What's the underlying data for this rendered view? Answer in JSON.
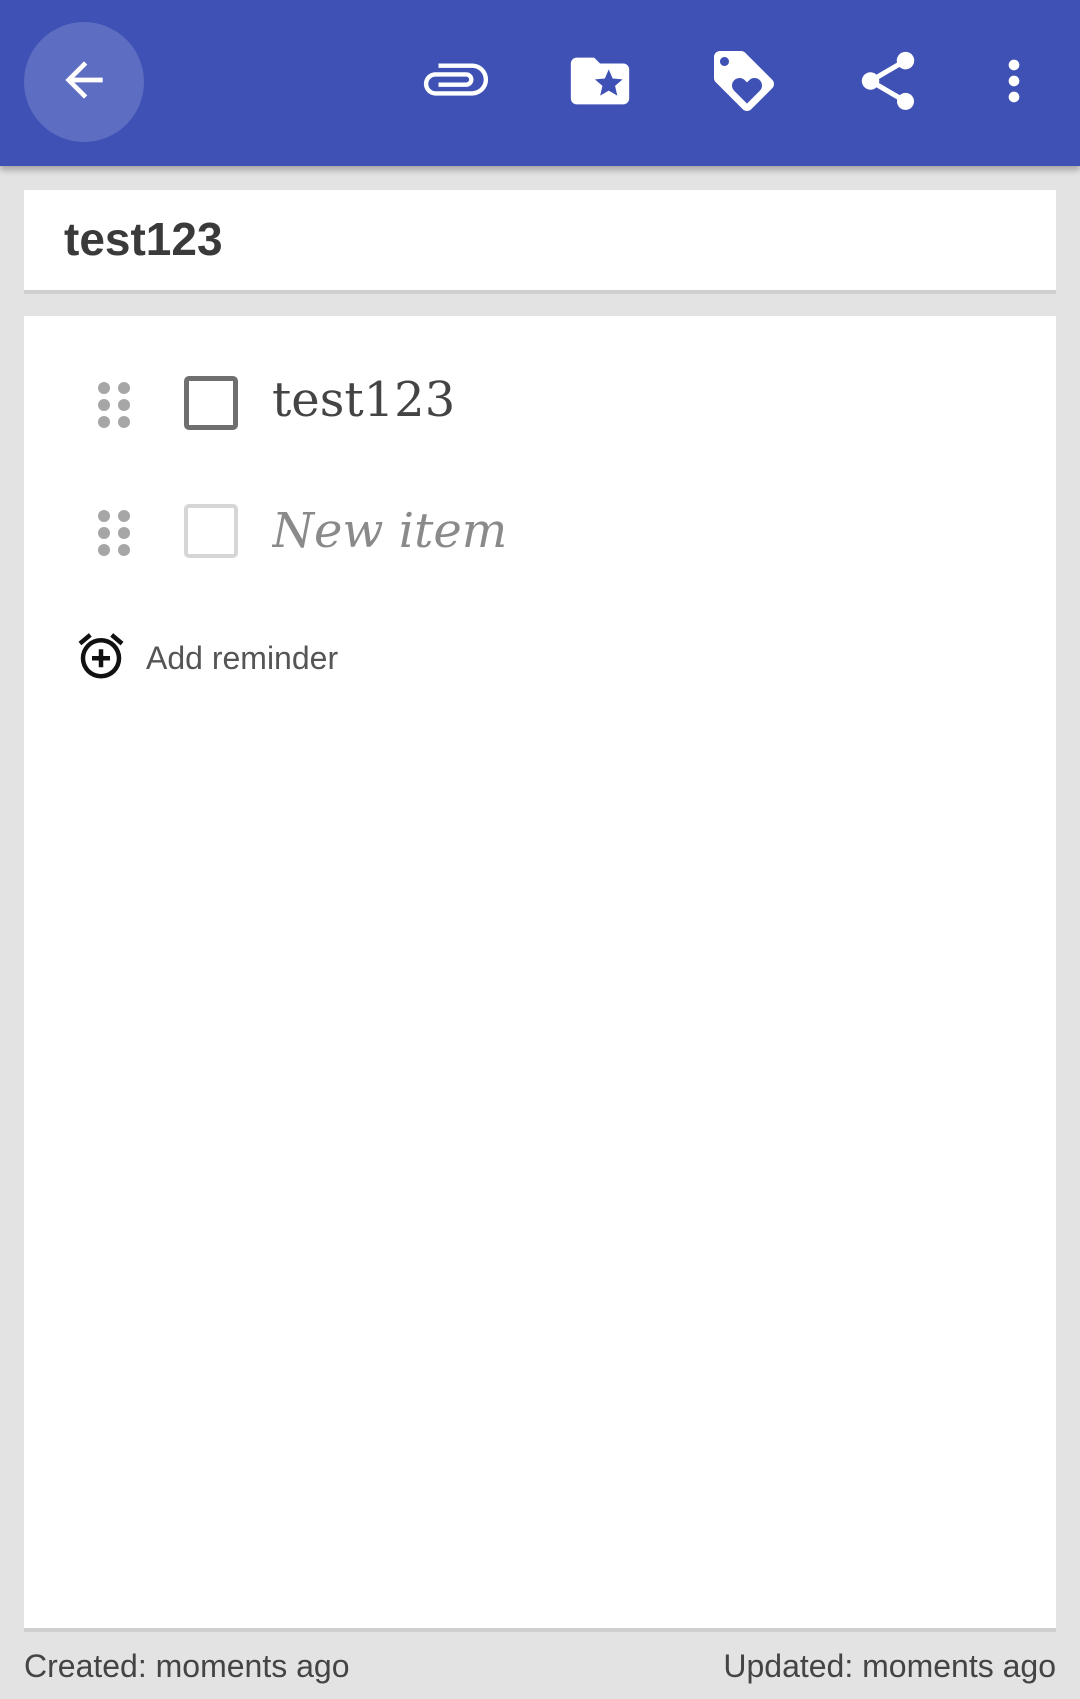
{
  "toolbar": {
    "background": "#3f51b5",
    "icons": [
      "back-arrow-icon",
      "paperclip-icon",
      "folder-star-icon",
      "tag-heart-icon",
      "share-icon",
      "more-vert-icon"
    ]
  },
  "note": {
    "title": "test123"
  },
  "checklist": {
    "items": [
      {
        "label": "test123",
        "checked": false
      }
    ],
    "new_item_placeholder": "New item"
  },
  "reminder": {
    "label": "Add reminder",
    "icon": "alarm-add-icon"
  },
  "footer": {
    "created": "Created: moments ago",
    "updated": "Updated: moments ago"
  }
}
